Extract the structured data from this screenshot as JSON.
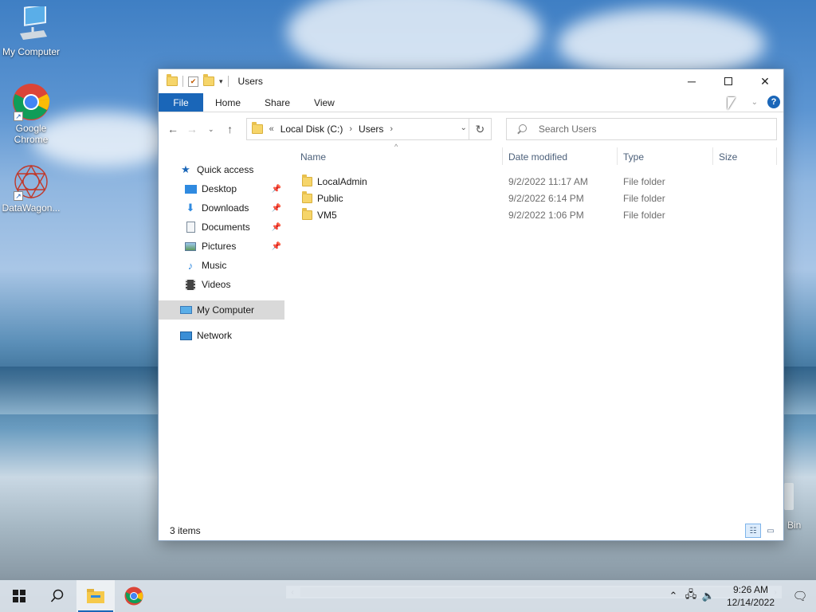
{
  "desktop": {
    "icons": [
      {
        "label": "My Computer",
        "icon": "computer-icon"
      },
      {
        "label": "Google Chrome",
        "icon": "chrome-icon"
      },
      {
        "label": "DataWagon...",
        "icon": "datawagon-icon"
      }
    ],
    "recycle_bin_label": "Bin"
  },
  "window": {
    "title": "Users",
    "ribbon_tabs": [
      "File",
      "Home",
      "Share",
      "View"
    ],
    "help_label": "?",
    "address": {
      "prefix": "«",
      "crumbs": [
        "Local Disk (C:)",
        "Users"
      ]
    },
    "search_placeholder": "Search Users",
    "nav_pane": {
      "quick_access": "Quick access",
      "pinned": [
        {
          "label": "Desktop",
          "pinned": true,
          "icon": "desktop-icon"
        },
        {
          "label": "Downloads",
          "pinned": true,
          "icon": "downloads-icon"
        },
        {
          "label": "Documents",
          "pinned": true,
          "icon": "documents-icon"
        },
        {
          "label": "Pictures",
          "pinned": true,
          "icon": "pictures-icon"
        },
        {
          "label": "Music",
          "pinned": false,
          "icon": "music-icon"
        },
        {
          "label": "Videos",
          "pinned": false,
          "icon": "videos-icon"
        }
      ],
      "my_computer": "My Computer",
      "network": "Network"
    },
    "columns": [
      "Name",
      "Date modified",
      "Type",
      "Size"
    ],
    "files": [
      {
        "name": "LocalAdmin",
        "date": "9/2/2022 11:17 AM",
        "type": "File folder"
      },
      {
        "name": "Public",
        "date": "9/2/2022 6:14 PM",
        "type": "File folder"
      },
      {
        "name": "VM5",
        "date": "9/2/2022 1:06 PM",
        "type": "File folder"
      }
    ],
    "status": "3 items"
  },
  "taskbar": {
    "time": "9:26 AM",
    "date": "12/14/2022"
  },
  "colors": {
    "accent": "#1a66b8",
    "selection": "#d9d9d9",
    "folder": "#f6d56a"
  }
}
